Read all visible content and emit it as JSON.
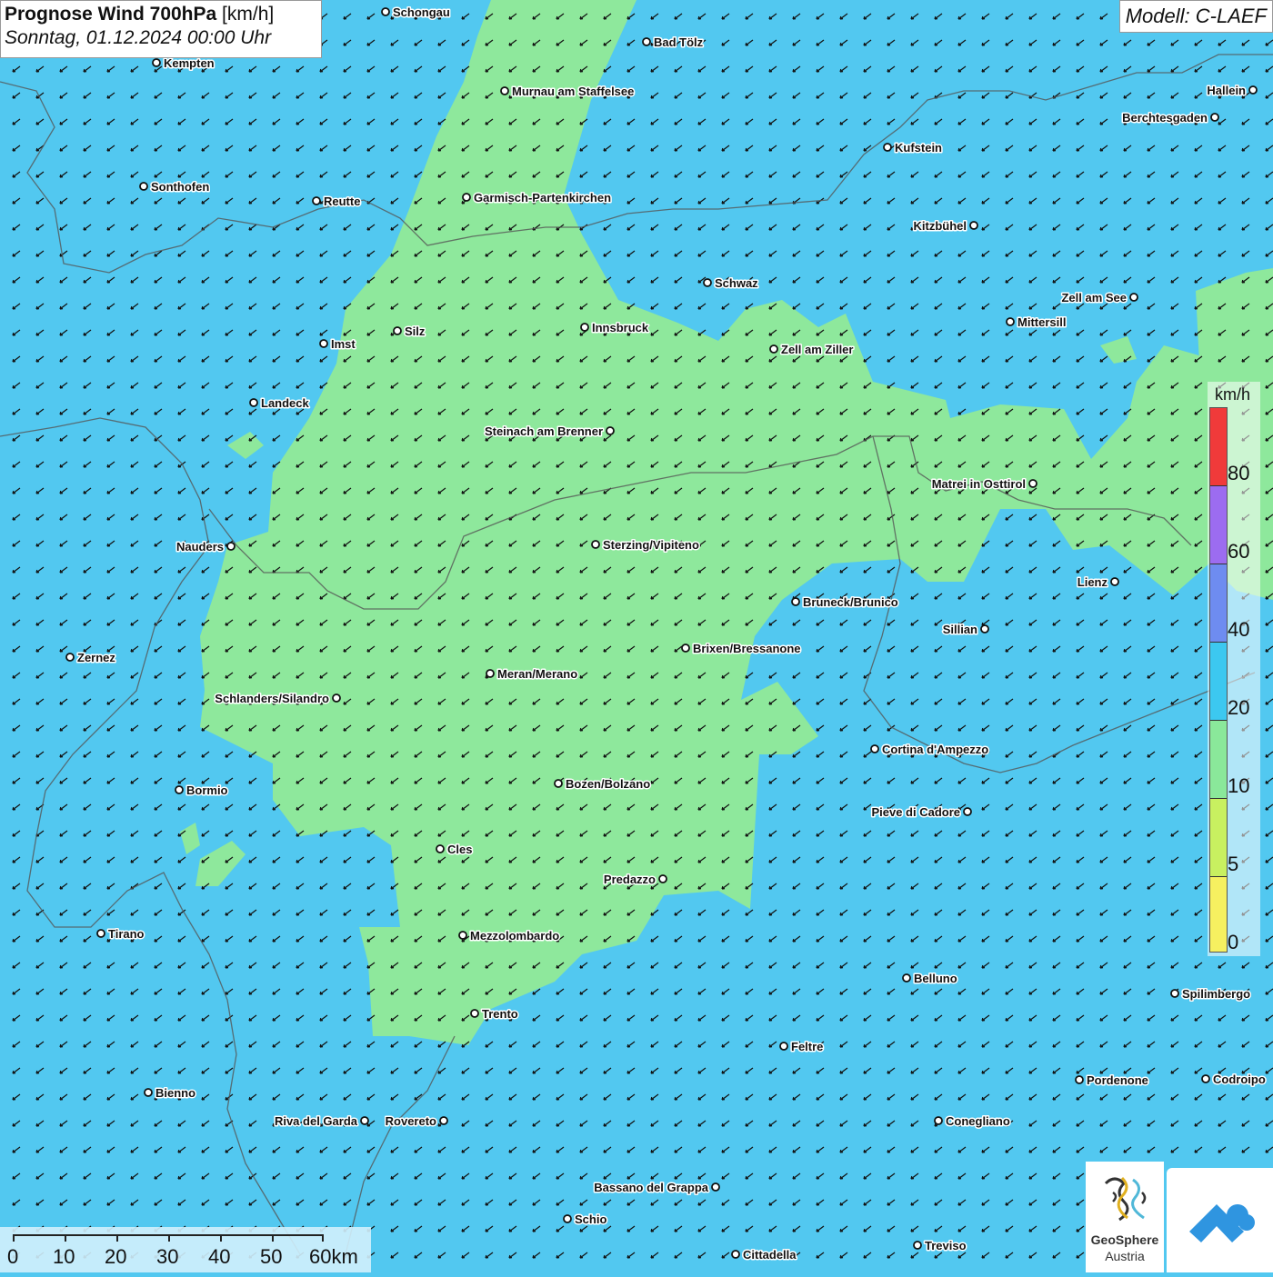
{
  "header": {
    "title_bold": "Prognose Wind 700hPa",
    "title_unit": "[km/h]",
    "datetime": "Sonntag, 01.12.2024 00:00 Uhr",
    "model": "Modell: C-LAEF"
  },
  "legend": {
    "unit": "km/h",
    "labels": [
      "80",
      "60",
      "40",
      "20",
      "10",
      "5",
      "0"
    ],
    "colors": [
      "#f03a3a",
      "#9c6cf0",
      "#6e8cf0",
      "#3cc8f0",
      "#8ae89a",
      "#c8f060",
      "#f6f060"
    ]
  },
  "scalebar": {
    "labels": [
      "0",
      "10",
      "20",
      "30",
      "40",
      "50",
      "60km"
    ]
  },
  "logo": {
    "name": "GeoSphere",
    "sub": "Austria"
  },
  "cities": [
    {
      "name": "Schongau"
    },
    {
      "name": "Bad Tölz"
    },
    {
      "name": "Kempten"
    },
    {
      "name": "Murnau am Staffelsee"
    },
    {
      "name": "Hallein"
    },
    {
      "name": "Berchtesgaden"
    },
    {
      "name": "Kufstein"
    },
    {
      "name": "Sonthofen"
    },
    {
      "name": "Reutte"
    },
    {
      "name": "Garmisch-Partenkirchen"
    },
    {
      "name": "Kitzbühel"
    },
    {
      "name": "Schwaz"
    },
    {
      "name": "Zell am See"
    },
    {
      "name": "Mittersill"
    },
    {
      "name": "Innsbruck"
    },
    {
      "name": "Silz"
    },
    {
      "name": "Imst"
    },
    {
      "name": "Zell am Ziller"
    },
    {
      "name": "Landeck"
    },
    {
      "name": "Steinach am Brenner"
    },
    {
      "name": "Matrei in Osttirol"
    },
    {
      "name": "Nauders"
    },
    {
      "name": "Sterzing/Vipiteno"
    },
    {
      "name": "Lienz"
    },
    {
      "name": "Bruneck/Brunico"
    },
    {
      "name": "Sillian"
    },
    {
      "name": "Brixen/Bressanone"
    },
    {
      "name": "Zernez"
    },
    {
      "name": "Meran/Merano"
    },
    {
      "name": "Schlanders/Silandro"
    },
    {
      "name": "Cortina d'Ampezzo"
    },
    {
      "name": "Bozen/Bolzano"
    },
    {
      "name": "Bormio"
    },
    {
      "name": "Pieve di Cadore"
    },
    {
      "name": "Cles"
    },
    {
      "name": "Predazzo"
    },
    {
      "name": "Tirano"
    },
    {
      "name": "Mezzolombardo"
    },
    {
      "name": "Belluno"
    },
    {
      "name": "Spilimbergo"
    },
    {
      "name": "Trento"
    },
    {
      "name": "Feltre"
    },
    {
      "name": "Pordenone"
    },
    {
      "name": "Codroipo"
    },
    {
      "name": "Bienno"
    },
    {
      "name": "Riva del Garda"
    },
    {
      "name": "Rovereto"
    },
    {
      "name": "Conegliano"
    },
    {
      "name": "Bassano del Grappa"
    },
    {
      "name": "Schio"
    },
    {
      "name": "Treviso"
    },
    {
      "name": "Cittadella"
    }
  ]
}
